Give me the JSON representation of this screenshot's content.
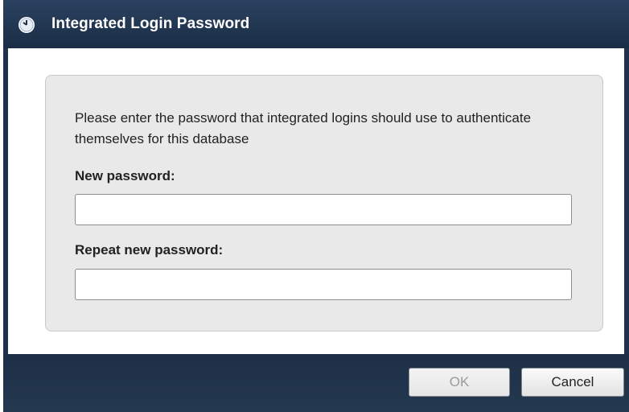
{
  "window": {
    "title": "Integrated Login Password",
    "icon": "clock-icon"
  },
  "panel": {
    "description": "Please enter the password that integrated logins should use to authenticate themselves for this database",
    "new_password_label": "New password:",
    "new_password_value": "",
    "repeat_password_label": "Repeat new password:",
    "repeat_password_value": ""
  },
  "buttons": {
    "ok_label": "OK",
    "ok_enabled": false,
    "cancel_label": "Cancel"
  },
  "colors": {
    "titlebar": "#1f3249",
    "panel_bg": "#e9e9e9",
    "disabled_text": "#9a9a9a"
  }
}
